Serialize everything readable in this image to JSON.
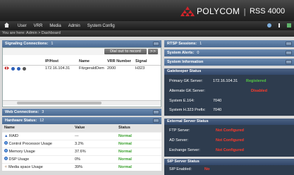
{
  "header": {
    "brand": "POLYCOM",
    "product": "RSS 4000",
    "brand_color": "#d0242a"
  },
  "nav": {
    "items": [
      "User",
      "VRR",
      "Media",
      "Admin",
      "System Config"
    ]
  },
  "breadcrumb": "You are here:  Admin  >  Dashboard",
  "signaling": {
    "title": "Signaling Connections:",
    "count": "1",
    "dial_out_label": "Dial out to record",
    "option_label": ">>",
    "columns": [
      "",
      "IP/Host",
      "Name",
      "VRR Number",
      "Signal"
    ],
    "rows": [
      {
        "ip": "172.16.104.31",
        "name": "FitzgeraldDem",
        "vrr": "2000",
        "signal": "H323"
      }
    ]
  },
  "web": {
    "title": "Web Connections:",
    "count": "3"
  },
  "hardware": {
    "title": "Hardware Status:",
    "count": "12",
    "columns": [
      "Name",
      "Value",
      "Status"
    ],
    "rows": [
      {
        "name": "RAID",
        "value": "---",
        "status": "Normal",
        "icon": "raid-icon"
      },
      {
        "name": "Control Processor Usage",
        "value": "3.2%",
        "status": "Normal",
        "icon": "cpu-icon"
      },
      {
        "name": "Memory Usage",
        "value": "37.6%",
        "status": "Normal",
        "icon": "memory-icon"
      },
      {
        "name": "DSP Usage",
        "value": "0%",
        "status": "Normal",
        "icon": "dsp-icon"
      },
      {
        "name": "Media space Usage",
        "value": "39%",
        "status": "Normal",
        "icon": "media-icon"
      }
    ]
  },
  "rtsp": {
    "title": "RTSP Sessions:",
    "count": "1"
  },
  "alerts": {
    "title": "System Alerts:",
    "count": "0"
  },
  "sysinfo": {
    "title": "System Information"
  },
  "gatekeeper": {
    "title": "Gatekeeper Status",
    "primary_label": "Primary GK Server:",
    "primary_value": "172.16.104.31",
    "primary_status": "Registered",
    "alternate_label": "Alternate GK Server:",
    "alternate_status": "Disabled",
    "e164_label": "System E.164:",
    "e164_value": "7040",
    "h323_label": "System H.323 Prefix:",
    "h323_value": "7040"
  },
  "external": {
    "title": "External Server Status",
    "ftp_label": "FTP Server:",
    "ftp_value": "Not Configured",
    "ad_label": "AD Server:",
    "ad_value": "Not Configured",
    "exchange_label": "Exchange Server:",
    "exchange_value": "Not Configured"
  },
  "sip": {
    "title": "SIP Server Status",
    "enabled_label": "SIP Enabled:",
    "enabled_value": "No"
  }
}
